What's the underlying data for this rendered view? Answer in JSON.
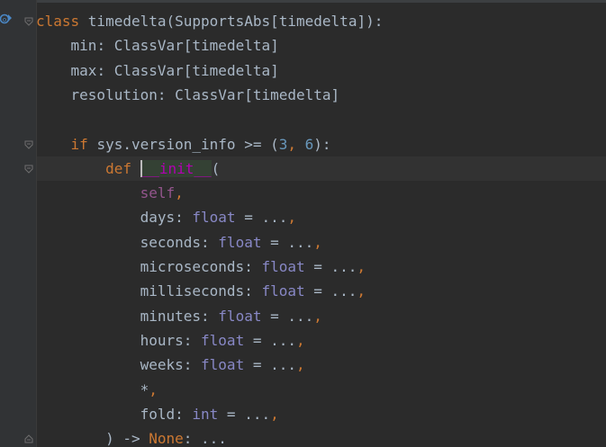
{
  "editor": {
    "language": "python",
    "lines": [
      {
        "tokens": [
          {
            "t": "class ",
            "c": "kw"
          },
          {
            "t": "timedelta",
            "c": "ident"
          },
          {
            "t": "(",
            "c": "punct"
          },
          {
            "t": "SupportsAbs",
            "c": "ident"
          },
          {
            "t": "[",
            "c": "punct"
          },
          {
            "t": "timedelta",
            "c": "ident"
          },
          {
            "t": "]):",
            "c": "punct"
          }
        ]
      },
      {
        "tokens": [
          {
            "t": "    min",
            "c": "ident"
          },
          {
            "t": ": ",
            "c": "punct"
          },
          {
            "t": "ClassVar",
            "c": "ident"
          },
          {
            "t": "[",
            "c": "punct"
          },
          {
            "t": "timedelta",
            "c": "ident"
          },
          {
            "t": "]",
            "c": "punct"
          }
        ]
      },
      {
        "tokens": [
          {
            "t": "    max",
            "c": "ident"
          },
          {
            "t": ": ",
            "c": "punct"
          },
          {
            "t": "ClassVar",
            "c": "ident"
          },
          {
            "t": "[",
            "c": "punct"
          },
          {
            "t": "timedelta",
            "c": "ident"
          },
          {
            "t": "]",
            "c": "punct"
          }
        ]
      },
      {
        "tokens": [
          {
            "t": "    resolution",
            "c": "ident"
          },
          {
            "t": ": ",
            "c": "punct"
          },
          {
            "t": "ClassVar",
            "c": "ident"
          },
          {
            "t": "[",
            "c": "punct"
          },
          {
            "t": "timedelta",
            "c": "ident"
          },
          {
            "t": "]",
            "c": "punct"
          }
        ]
      },
      {
        "tokens": []
      },
      {
        "tokens": [
          {
            "t": "    ",
            "c": "ident"
          },
          {
            "t": "if ",
            "c": "kw"
          },
          {
            "t": "sys.version_info ",
            "c": "ident"
          },
          {
            "t": ">= (",
            "c": "punct"
          },
          {
            "t": "3",
            "c": "num"
          },
          {
            "t": ", ",
            "c": "kw"
          },
          {
            "t": "6",
            "c": "num"
          },
          {
            "t": "):",
            "c": "punct"
          }
        ]
      },
      {
        "current": true,
        "tokens": [
          {
            "t": "        ",
            "c": "ident"
          },
          {
            "t": "def ",
            "c": "kw"
          },
          {
            "t": "__init__",
            "c": "dunder",
            "hl": true
          },
          {
            "t": "(",
            "c": "punct"
          }
        ]
      },
      {
        "tokens": [
          {
            "t": "            ",
            "c": "ident"
          },
          {
            "t": "self",
            "c": "self"
          },
          {
            "t": ",",
            "c": "kw"
          }
        ]
      },
      {
        "tokens": [
          {
            "t": "            days",
            "c": "param"
          },
          {
            "t": ": ",
            "c": "punct"
          },
          {
            "t": "float",
            "c": "builtin-type"
          },
          {
            "t": " = ...",
            "c": "punct"
          },
          {
            "t": ",",
            "c": "kw"
          }
        ]
      },
      {
        "tokens": [
          {
            "t": "            seconds",
            "c": "param"
          },
          {
            "t": ": ",
            "c": "punct"
          },
          {
            "t": "float",
            "c": "builtin-type"
          },
          {
            "t": " = ...",
            "c": "punct"
          },
          {
            "t": ",",
            "c": "kw"
          }
        ]
      },
      {
        "tokens": [
          {
            "t": "            microseconds",
            "c": "param"
          },
          {
            "t": ": ",
            "c": "punct"
          },
          {
            "t": "float",
            "c": "builtin-type"
          },
          {
            "t": " = ...",
            "c": "punct"
          },
          {
            "t": ",",
            "c": "kw"
          }
        ]
      },
      {
        "tokens": [
          {
            "t": "            milliseconds",
            "c": "param"
          },
          {
            "t": ": ",
            "c": "punct"
          },
          {
            "t": "float",
            "c": "builtin-type"
          },
          {
            "t": " = ...",
            "c": "punct"
          },
          {
            "t": ",",
            "c": "kw"
          }
        ]
      },
      {
        "tokens": [
          {
            "t": "            minutes",
            "c": "param"
          },
          {
            "t": ": ",
            "c": "punct"
          },
          {
            "t": "float",
            "c": "builtin-type"
          },
          {
            "t": " = ...",
            "c": "punct"
          },
          {
            "t": ",",
            "c": "kw"
          }
        ]
      },
      {
        "tokens": [
          {
            "t": "            hours",
            "c": "param"
          },
          {
            "t": ": ",
            "c": "punct"
          },
          {
            "t": "float",
            "c": "builtin-type"
          },
          {
            "t": " = ...",
            "c": "punct"
          },
          {
            "t": ",",
            "c": "kw"
          }
        ]
      },
      {
        "tokens": [
          {
            "t": "            weeks",
            "c": "param"
          },
          {
            "t": ": ",
            "c": "punct"
          },
          {
            "t": "float",
            "c": "builtin-type"
          },
          {
            "t": " = ...",
            "c": "punct"
          },
          {
            "t": ",",
            "c": "kw"
          }
        ]
      },
      {
        "tokens": [
          {
            "t": "            *",
            "c": "punct"
          },
          {
            "t": ",",
            "c": "kw"
          }
        ]
      },
      {
        "tokens": [
          {
            "t": "            fold",
            "c": "param"
          },
          {
            "t": ": ",
            "c": "punct"
          },
          {
            "t": "int",
            "c": "builtin-type"
          },
          {
            "t": " = ...",
            "c": "punct"
          },
          {
            "t": ",",
            "c": "kw"
          }
        ]
      },
      {
        "tokens": [
          {
            "t": "        ) -> ",
            "c": "punct"
          },
          {
            "t": "None",
            "c": "kw"
          },
          {
            "t": ": ...",
            "c": "punct"
          }
        ]
      }
    ],
    "gutter": {
      "implementation_icon": "implemented-method-icon",
      "fold_markers": [
        {
          "line": 0,
          "icon": "fold-open-icon"
        },
        {
          "line": 5,
          "icon": "fold-open-icon"
        },
        {
          "line": 6,
          "icon": "fold-open-icon"
        },
        {
          "line": 17,
          "icon": "fold-close-icon"
        }
      ]
    },
    "colors": {
      "background": "#2b2b2b",
      "gutter": "#313335",
      "keyword": "#cc7832",
      "number": "#6897bb",
      "self": "#94558d",
      "dunder": "#b200b2",
      "builtin_type": "#8888c6",
      "text": "#a9b7c6",
      "current_line": "#323232"
    }
  }
}
